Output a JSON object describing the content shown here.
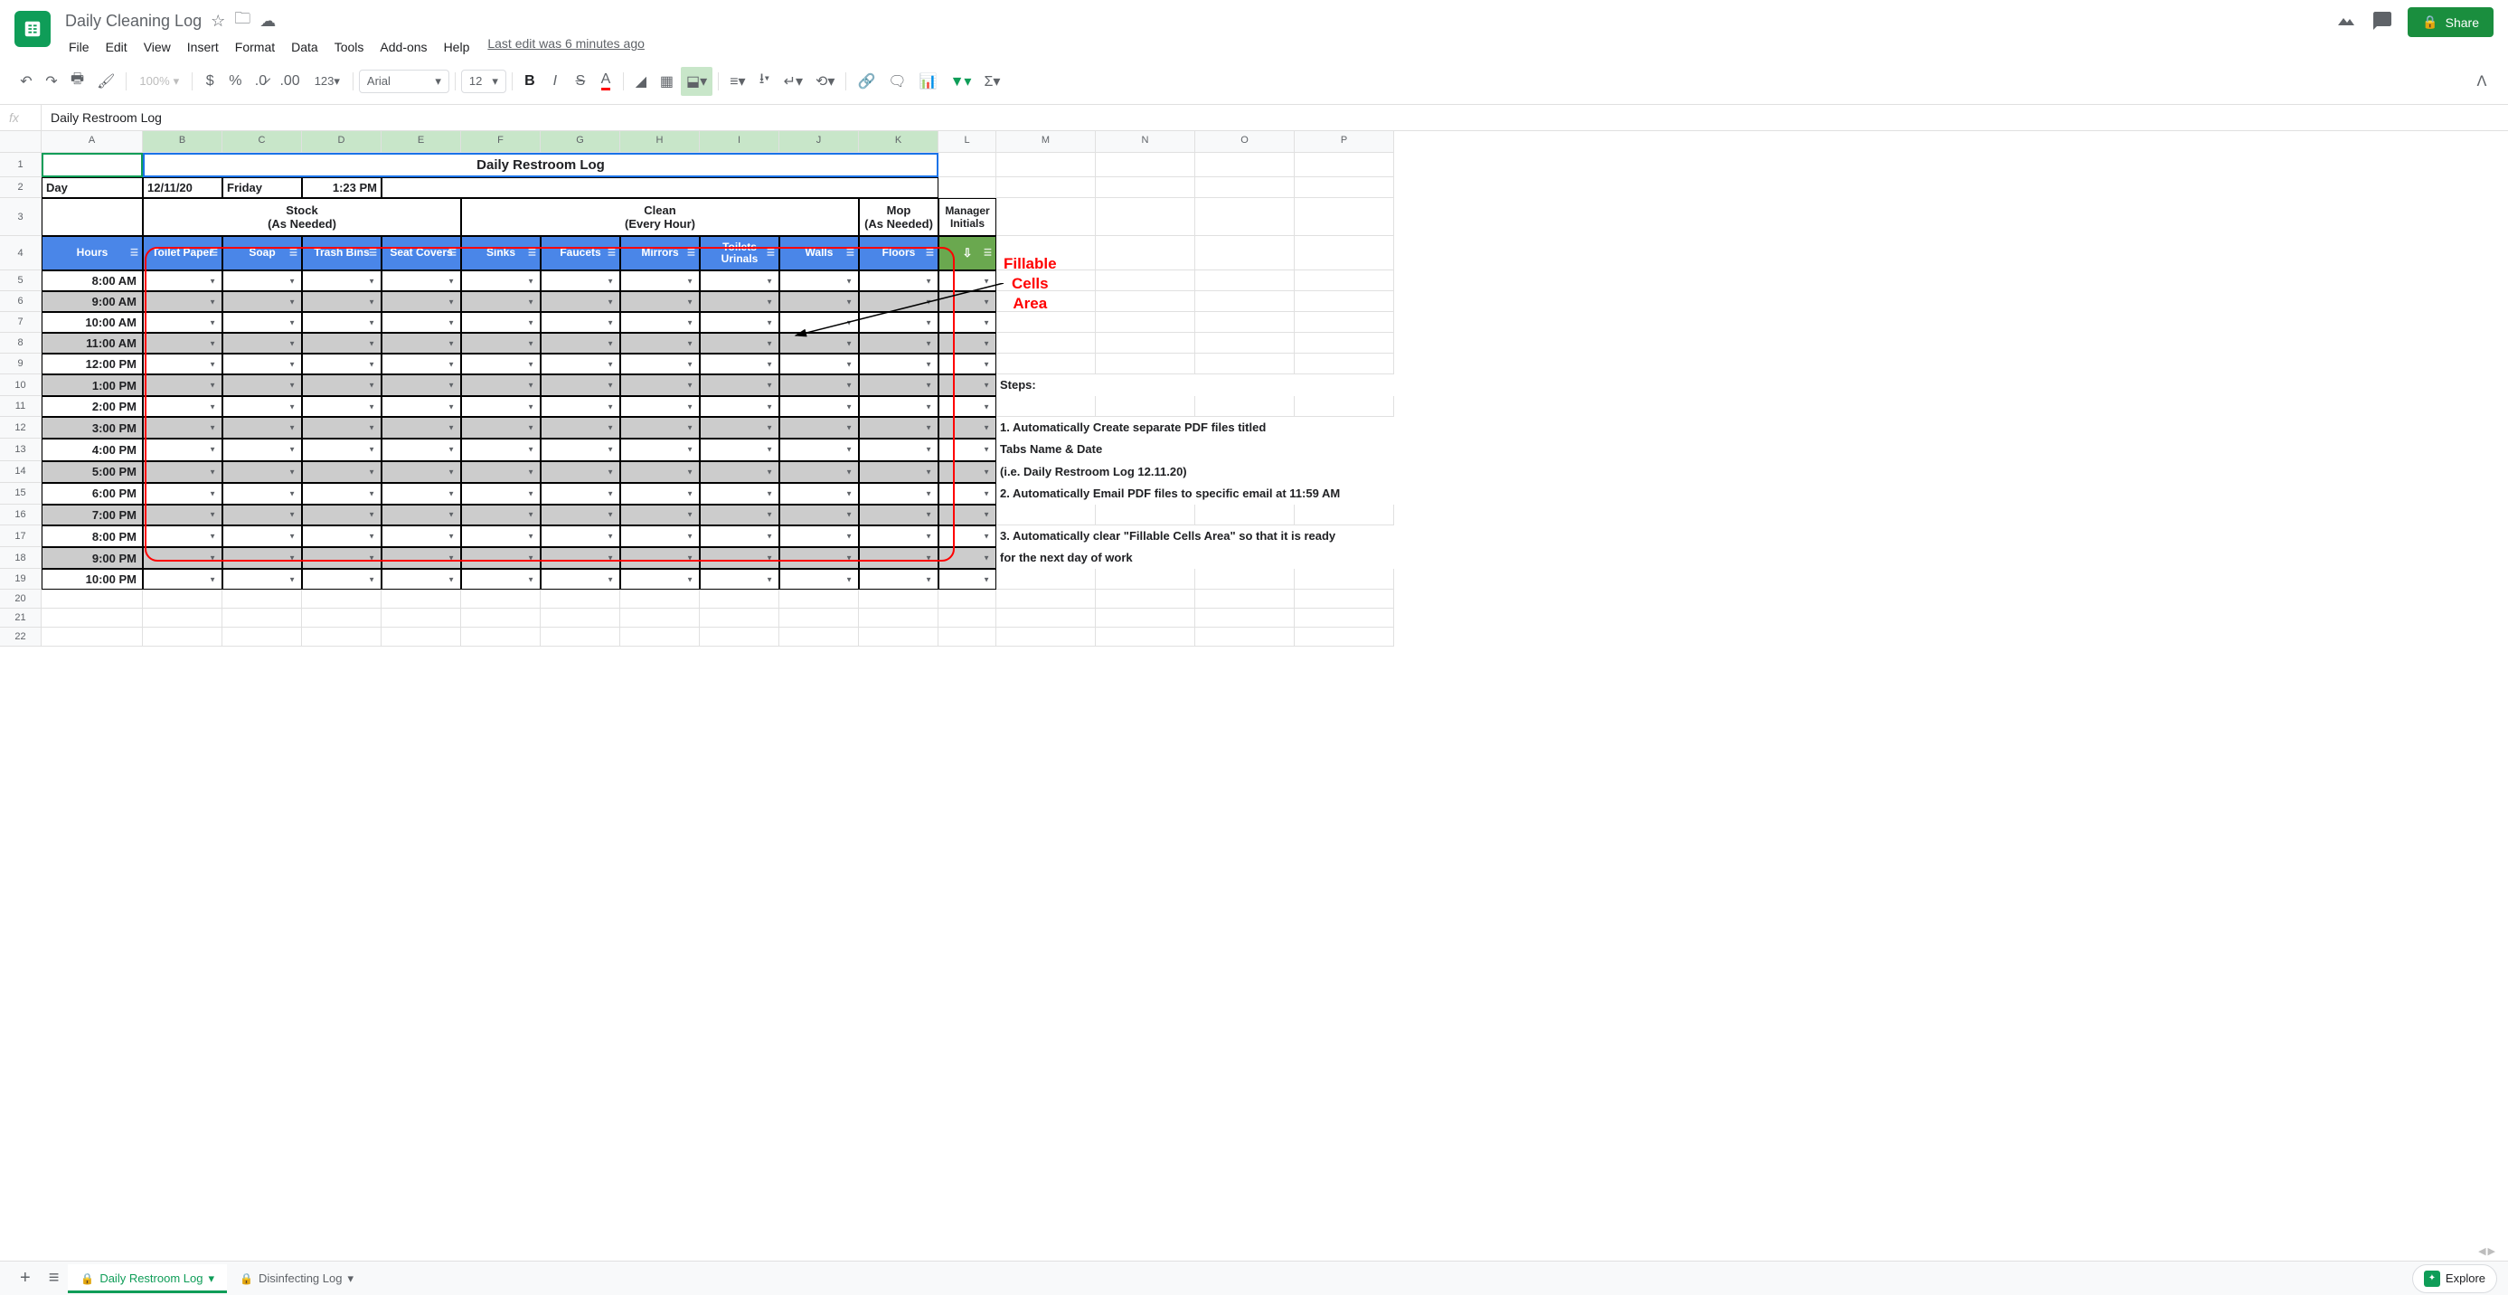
{
  "doc_title": "Daily Cleaning Log",
  "menu": {
    "file": "File",
    "edit": "Edit",
    "view": "View",
    "insert": "Insert",
    "format": "Format",
    "data": "Data",
    "tools": "Tools",
    "addons": "Add-ons",
    "help": "Help"
  },
  "last_edit": "Last edit was 6 minutes ago",
  "share": "Share",
  "toolbar": {
    "zoom": "100%",
    "font": "Arial",
    "size": "12"
  },
  "formula_bar": "Daily Restroom Log",
  "columns": [
    "A",
    "B",
    "C",
    "D",
    "E",
    "F",
    "G",
    "H",
    "I",
    "J",
    "K",
    "L",
    "M",
    "N",
    "O",
    "P"
  ],
  "rows": [
    "1",
    "2",
    "3",
    "4",
    "5",
    "6",
    "7",
    "8",
    "9",
    "10",
    "11",
    "12",
    "13",
    "14",
    "15",
    "16",
    "17",
    "18",
    "19",
    "20",
    "21",
    "22"
  ],
  "sheet_title": "Daily Restroom Log",
  "day_label": "Day",
  "date_val": "12/11/20",
  "weekday": "Friday",
  "time_val": "1:23 PM",
  "group_headers": {
    "stock": "Stock",
    "stock_sub": "(As Needed)",
    "clean": "Clean",
    "clean_sub": "(Every Hour)",
    "mop": "Mop",
    "mop_sub": "(As Needed)",
    "mgr": "Manager",
    "mgr_sub": "Initials"
  },
  "col_headers": {
    "hours": "Hours",
    "toilet_paper": "Toilet Paper",
    "soap": "Soap",
    "trash": "Trash Bins",
    "seat": "Seat Covers",
    "sinks": "Sinks",
    "faucets": "Faucets",
    "mirrors": "Mirrors",
    "toilets": "Toilets Urinals",
    "walls": "Walls",
    "floors": "Floors",
    "down": "⇩"
  },
  "hours": [
    "8:00 AM",
    "9:00 AM",
    "10:00 AM",
    "11:00 AM",
    "12:00 PM",
    "1:00 PM",
    "2:00 PM",
    "3:00 PM",
    "4:00 PM",
    "5:00 PM",
    "6:00 PM",
    "7:00 PM",
    "8:00 PM",
    "9:00 PM",
    "10:00 PM"
  ],
  "annotation": {
    "label": "Fillable\nCells\nArea",
    "steps_title": "Steps:",
    "step1a": "1. Automatically Create separate PDF files titled",
    "step1b": "    Tabs Name & Date",
    "step1c": "    (i.e. Daily Restroom Log 12.11.20)",
    "step2": "2. Automatically Email PDF files to specific email at 11:59 AM",
    "step3a": "3. Automatically clear \"Fillable Cells Area\" so that it is ready",
    "step3b": "    for the next day of work"
  },
  "tabs": {
    "log": "Daily Restroom Log",
    "dis": "Disinfecting Log"
  },
  "explore": "Explore"
}
